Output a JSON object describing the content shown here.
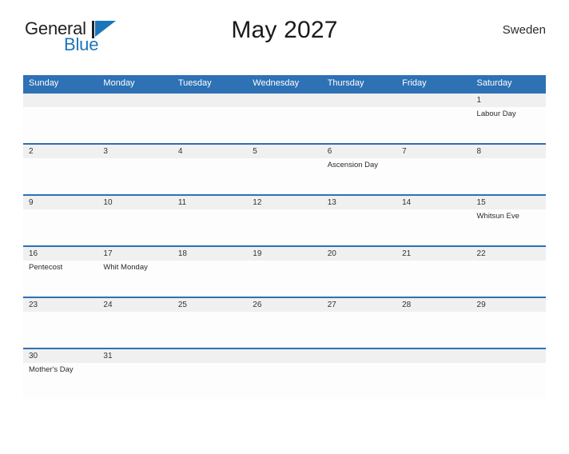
{
  "brand": {
    "name_part1": "General",
    "name_part2": "Blue",
    "mark_icon": "blue-flag-triangle-icon",
    "accent_color": "#1b75bb"
  },
  "header": {
    "title": "May 2027",
    "country": "Sweden"
  },
  "theme": {
    "header_blue": "#2e71b5",
    "row_border_blue": "#2e71b5",
    "day_band_gray": "#f0f0f0",
    "cell_white": "#fdfdfd"
  },
  "calendar": {
    "month": "May",
    "year": "2027",
    "weekday_headers": [
      "Sunday",
      "Monday",
      "Tuesday",
      "Wednesday",
      "Thursday",
      "Friday",
      "Saturday"
    ],
    "weeks": [
      {
        "days": [
          {
            "number": "",
            "event": ""
          },
          {
            "number": "",
            "event": ""
          },
          {
            "number": "",
            "event": ""
          },
          {
            "number": "",
            "event": ""
          },
          {
            "number": "",
            "event": ""
          },
          {
            "number": "",
            "event": ""
          },
          {
            "number": "1",
            "event": "Labour Day"
          }
        ]
      },
      {
        "days": [
          {
            "number": "2",
            "event": ""
          },
          {
            "number": "3",
            "event": ""
          },
          {
            "number": "4",
            "event": ""
          },
          {
            "number": "5",
            "event": ""
          },
          {
            "number": "6",
            "event": "Ascension Day"
          },
          {
            "number": "7",
            "event": ""
          },
          {
            "number": "8",
            "event": ""
          }
        ]
      },
      {
        "days": [
          {
            "number": "9",
            "event": ""
          },
          {
            "number": "10",
            "event": ""
          },
          {
            "number": "11",
            "event": ""
          },
          {
            "number": "12",
            "event": ""
          },
          {
            "number": "13",
            "event": ""
          },
          {
            "number": "14",
            "event": ""
          },
          {
            "number": "15",
            "event": "Whitsun Eve"
          }
        ]
      },
      {
        "days": [
          {
            "number": "16",
            "event": "Pentecost"
          },
          {
            "number": "17",
            "event": "Whit Monday"
          },
          {
            "number": "18",
            "event": ""
          },
          {
            "number": "19",
            "event": ""
          },
          {
            "number": "20",
            "event": ""
          },
          {
            "number": "21",
            "event": ""
          },
          {
            "number": "22",
            "event": ""
          }
        ]
      },
      {
        "days": [
          {
            "number": "23",
            "event": ""
          },
          {
            "number": "24",
            "event": ""
          },
          {
            "number": "25",
            "event": ""
          },
          {
            "number": "26",
            "event": ""
          },
          {
            "number": "27",
            "event": ""
          },
          {
            "number": "28",
            "event": ""
          },
          {
            "number": "29",
            "event": ""
          }
        ]
      },
      {
        "days": [
          {
            "number": "30",
            "event": "Mother's Day"
          },
          {
            "number": "31",
            "event": ""
          },
          {
            "number": "",
            "event": ""
          },
          {
            "number": "",
            "event": ""
          },
          {
            "number": "",
            "event": ""
          },
          {
            "number": "",
            "event": ""
          },
          {
            "number": "",
            "event": ""
          }
        ]
      }
    ]
  }
}
